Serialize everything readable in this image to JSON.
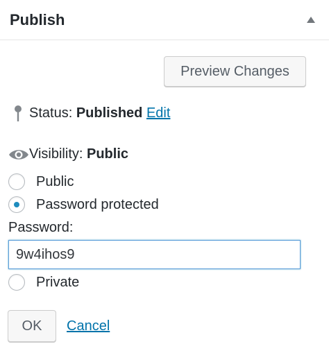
{
  "panel": {
    "title": "Publish",
    "toggle_icon": "triangle-up-icon"
  },
  "actions": {
    "preview_label": "Preview Changes"
  },
  "status": {
    "icon": "pin-icon",
    "label": "Status:",
    "value": "Published",
    "edit_label": "Edit"
  },
  "visibility": {
    "icon": "eye-icon",
    "label": "Visibility:",
    "value": "Public",
    "options": [
      {
        "label": "Public",
        "checked": false
      },
      {
        "label": "Password protected",
        "checked": true
      },
      {
        "label": "Private",
        "checked": false
      }
    ],
    "password_label": "Password:",
    "password_value": "9w4ihos9",
    "ok_label": "OK",
    "cancel_label": "Cancel"
  },
  "colors": {
    "link": "#0073aa",
    "radio_checked": "#1e8cbe",
    "input_focus_border": "#5b9dd9"
  }
}
